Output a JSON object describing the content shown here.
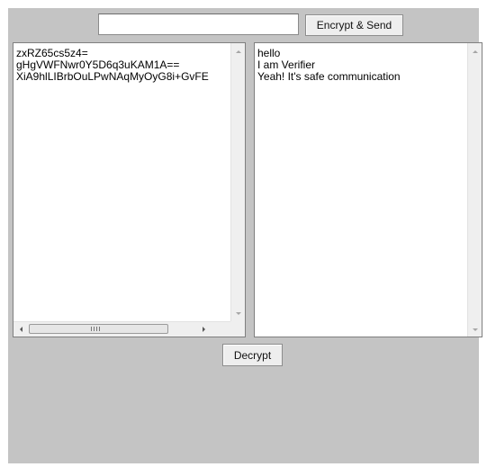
{
  "toolbar": {
    "message_input_value": "",
    "send_button_label": "Encrypt & Send"
  },
  "encrypted_pane": {
    "text": "zxRZ65cs5z4=\ngHgVWFNwr0Y5D6q3uKAM1A==\nXiA9hlLIBrbOuLPwNAqMyOyG8i+GvFE"
  },
  "decrypted_pane": {
    "text": "hello\nI am Verifier\nYeah! It's safe communication"
  },
  "footer": {
    "decrypt_button_label": "Decrypt"
  }
}
